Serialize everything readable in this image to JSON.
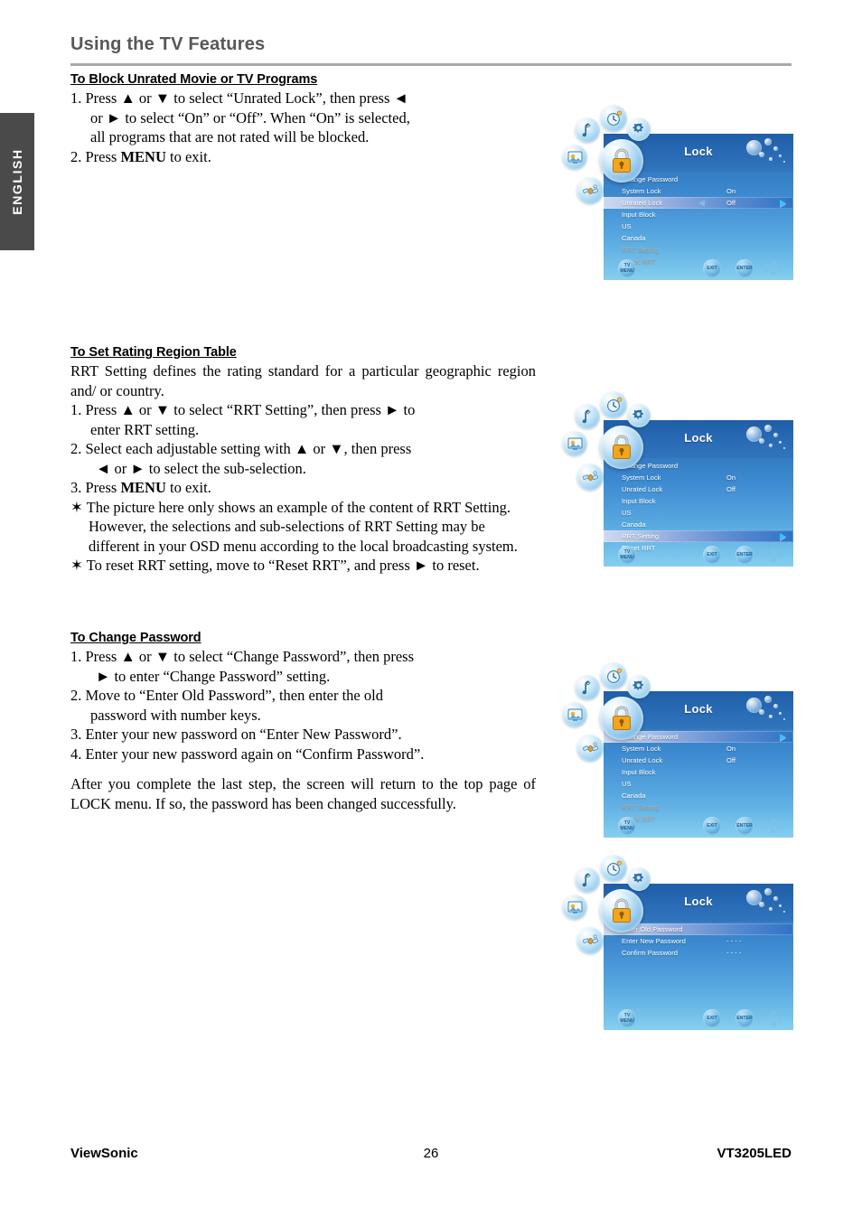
{
  "language_tab": "ENGLISH",
  "page_title": "Using the TV Features",
  "sections": [
    {
      "heading": "To Block Unrated Movie or TV Programs",
      "steps": [
        "1. Press ▲ or ▼ to select “Unrated Lock”, then press ◄",
        "or ► to select “On” or “Off”. When “On” is selected,",
        "all programs that are not rated will be blocked.",
        "2. Press MENU to exit."
      ],
      "step_menu_word": "MENU"
    },
    {
      "heading": "To Set Rating Region Table",
      "intro": "RRT Setting defines the rating standard for a particular geographic region and/ or country.",
      "step1a": "1. Press ▲ or ▼ to select “RRT Setting”, then press ► to",
      "step1b": "enter RRT setting.",
      "step2a": "2. Select each adjustable setting with ▲ or ▼, then press",
      "step2b": "◄ or ► to select the sub-selection.",
      "step3pre": "3. Press ",
      "step3bold": "MENU",
      "step3post": " to exit.",
      "note1": "✶ The picture here only shows an example of the content of RRT Setting. However, the selections and sub-selections of RRT Setting may be different in your OSD menu according to the local broadcasting system.",
      "note2": "✶ To reset RRT setting, move to “Reset RRT”, and press ► to reset."
    },
    {
      "heading": "To Change Password",
      "step1a": "1. Press ▲ or ▼ to select “Change Password”, then press",
      "step1b": "► to enter “Change Password” setting.",
      "step2a": "2. Move to “Enter Old Password”, then enter the old",
      "step2b": "password with number keys.",
      "step3": "3. Enter your new password on “Enter New Password”.",
      "step4": "4. Enter your new password again on “Confirm Password”.",
      "closing": "After you complete the last step, the screen will return to the top page of LOCK menu. If so, the password has been changed successfully."
    }
  ],
  "osd_common": {
    "title": "Lock",
    "buttons": {
      "menu_top": "TV",
      "menu": "MENU",
      "exit": "EXIT",
      "enter": "ENTER"
    },
    "icons": [
      "picture-icon",
      "music-icon",
      "clock-icon",
      "gear-icon",
      "lock-icon",
      "satellite-icon"
    ]
  },
  "osd_screens": [
    {
      "name": "unrated-lock-selected",
      "rows": [
        {
          "label": "Change Password",
          "value": "",
          "state": "normal",
          "arrow_right": false,
          "arrow_left": false
        },
        {
          "label": "System Lock",
          "value": "On",
          "state": "normal",
          "arrow_right": false,
          "arrow_left": false
        },
        {
          "label": "Unrated Lock",
          "value": "Off",
          "state": "selected",
          "arrow_right": true,
          "arrow_left": true
        },
        {
          "label": "Input Block",
          "value": "",
          "state": "normal",
          "arrow_right": false,
          "arrow_left": false
        },
        {
          "label": "US",
          "value": "",
          "state": "normal",
          "arrow_right": false,
          "arrow_left": false
        },
        {
          "label": "Canada",
          "value": "",
          "state": "normal",
          "arrow_right": false,
          "arrow_left": false
        },
        {
          "label": "RRT Setting",
          "value": "",
          "state": "dim",
          "arrow_right": false,
          "arrow_left": false
        },
        {
          "label": "Reset RRT",
          "value": "",
          "state": "dim",
          "arrow_right": false,
          "arrow_left": false
        }
      ]
    },
    {
      "name": "rrt-setting-selected",
      "rows": [
        {
          "label": "Change Password",
          "value": "",
          "state": "normal",
          "arrow_right": false,
          "arrow_left": false
        },
        {
          "label": "System Lock",
          "value": "On",
          "state": "normal",
          "arrow_right": false,
          "arrow_left": false
        },
        {
          "label": "Unrated Lock",
          "value": "Off",
          "state": "normal",
          "arrow_right": false,
          "arrow_left": false
        },
        {
          "label": "Input Block",
          "value": "",
          "state": "normal",
          "arrow_right": false,
          "arrow_left": false
        },
        {
          "label": "US",
          "value": "",
          "state": "normal",
          "arrow_right": false,
          "arrow_left": false
        },
        {
          "label": "Canada",
          "value": "",
          "state": "normal",
          "arrow_right": false,
          "arrow_left": false
        },
        {
          "label": "RRT Setting",
          "value": "",
          "state": "selected",
          "arrow_right": true,
          "arrow_left": false
        },
        {
          "label": "Reset RRT",
          "value": "",
          "state": "normal",
          "arrow_right": false,
          "arrow_left": false
        }
      ]
    },
    {
      "name": "change-password-selected",
      "rows": [
        {
          "label": "Change Password",
          "value": "",
          "state": "selected",
          "arrow_right": true,
          "arrow_left": false
        },
        {
          "label": "System Lock",
          "value": "On",
          "state": "normal",
          "arrow_right": false,
          "arrow_left": false
        },
        {
          "label": "Unrated Lock",
          "value": "Off",
          "state": "normal",
          "arrow_right": false,
          "arrow_left": false
        },
        {
          "label": "Input Block",
          "value": "",
          "state": "normal",
          "arrow_right": false,
          "arrow_left": false
        },
        {
          "label": "US",
          "value": "",
          "state": "normal",
          "arrow_right": false,
          "arrow_left": false
        },
        {
          "label": "Canada",
          "value": "",
          "state": "normal",
          "arrow_right": false,
          "arrow_left": false
        },
        {
          "label": "RRT Setting",
          "value": "",
          "state": "dim",
          "arrow_right": false,
          "arrow_left": false
        },
        {
          "label": "Reset RRT",
          "value": "",
          "state": "dim",
          "arrow_right": false,
          "arrow_left": false
        }
      ]
    },
    {
      "name": "password-entry",
      "rows": [
        {
          "label": "Enter Old Password",
          "value": "",
          "state": "selected",
          "arrow_right": false,
          "arrow_left": false
        },
        {
          "label": "Enter New Password",
          "value": "- - - -",
          "state": "normal",
          "arrow_right": false,
          "arrow_left": false
        },
        {
          "label": "Confirm Password",
          "value": "- - - -",
          "state": "normal",
          "arrow_right": false,
          "arrow_left": false
        }
      ]
    }
  ],
  "footer": {
    "brand": "ViewSonic",
    "page_number": "26",
    "model": "VT3205LED"
  }
}
